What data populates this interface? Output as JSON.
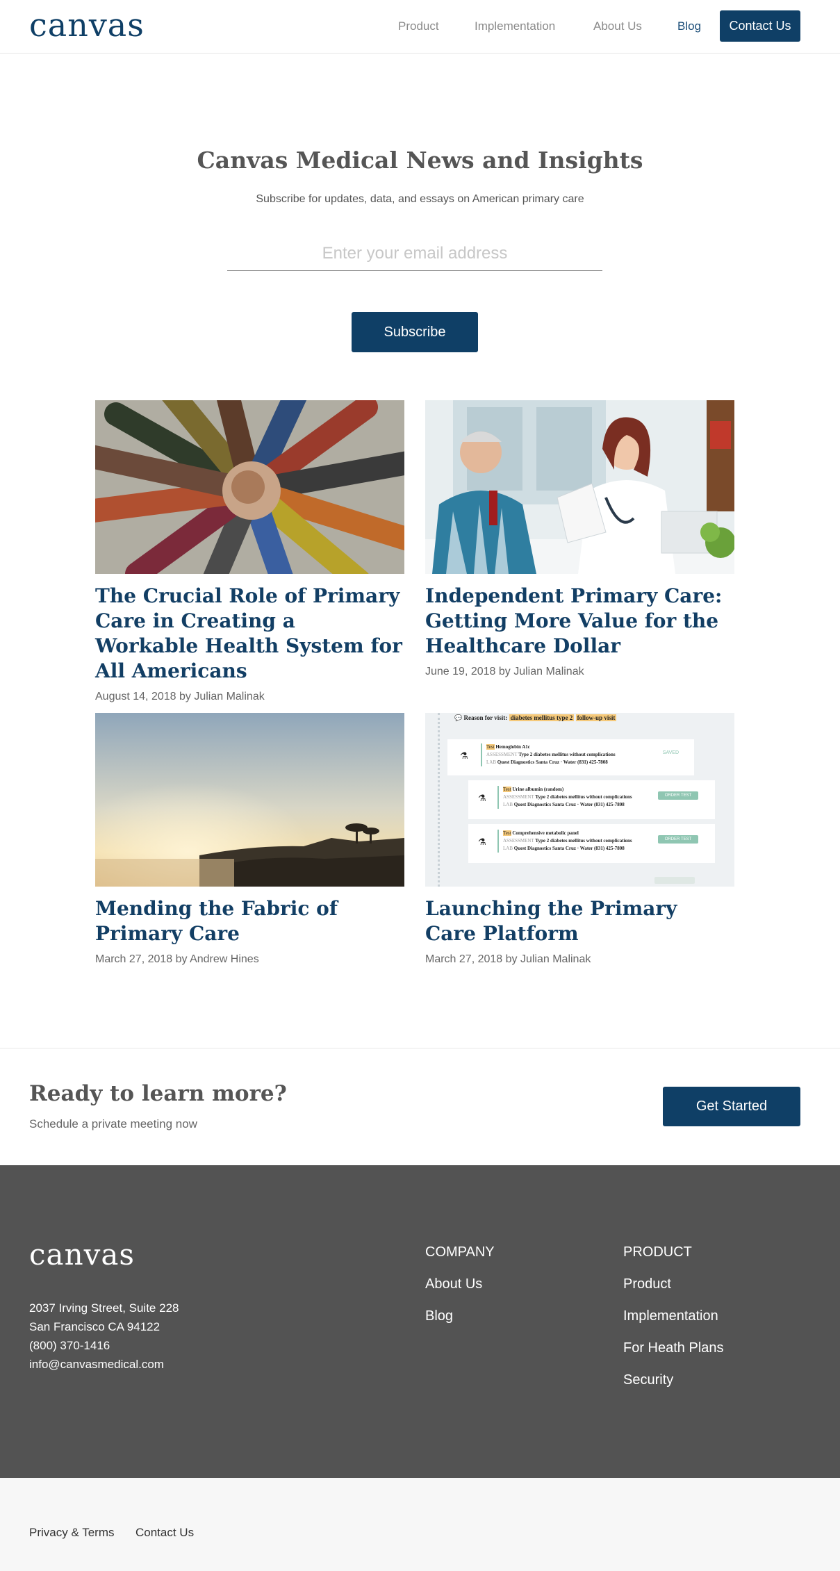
{
  "header": {
    "logo": "canvas",
    "nav": [
      "Product",
      "Implementation",
      "About Us",
      "Blog"
    ],
    "contact_label": "Contact Us"
  },
  "hero": {
    "title": "Canvas Medical News and Insights",
    "subtitle": "Subscribe for updates, data, and essays on American primary care",
    "email_placeholder": "Enter your email address",
    "subscribe_label": "Subscribe"
  },
  "posts": [
    {
      "title": "The Crucial Role of Primary Care in Creating a Workable Health System for All Americans",
      "meta": "August 14, 2018 by Julian Malinak"
    },
    {
      "title": "Independent Primary Care: Getting More Value for the Healthcare Dollar",
      "meta": "June 19, 2018 by Julian Malinak"
    },
    {
      "title": "Mending the Fabric of Primary Care",
      "meta": "March 27, 2018 by Andrew Hines"
    },
    {
      "title": "Launching the Primary Care Platform",
      "meta": "March 27, 2018 by Julian Malinak"
    }
  ],
  "screenshot_card": {
    "reason_label": "Reason for visit:",
    "reason_tag1": "diabetes mellitus type 2",
    "reason_tag2": "follow-up visit",
    "saved": "SAVED",
    "test_tag": "Test",
    "items": [
      {
        "name": "Hemoglobin A1c",
        "assessment": "Type 2 diabetes mellitus without complications",
        "lab": "Quest Diagnostics Santa Cruz · Water (831) 425-7808"
      },
      {
        "name": "Urine albumin (random)",
        "assessment": "Type 2 diabetes mellitus without complications",
        "lab": "Quest Diagnostics Santa Cruz · Water (831) 425-7808",
        "button": "ORDER TEST"
      },
      {
        "name": "Comprehensive metabolic panel",
        "assessment": "Type 2 diabetes mellitus without complications",
        "lab": "Quest Diagnostics Santa Cruz · Water (831) 425-7808",
        "button": "ORDER TEST"
      }
    ],
    "assessment_prefix": "ASSESSMENT",
    "lab_prefix": "LAB"
  },
  "cta": {
    "title": "Ready to learn more?",
    "subtitle": "Schedule a private meeting now",
    "button": "Get Started"
  },
  "footer": {
    "logo": "canvas",
    "address": [
      "2037 Irving Street, Suite 228",
      "San Francisco CA 94122",
      "(800) 370-1416",
      "info@canvasmedical.com"
    ],
    "company": {
      "title": "COMPANY",
      "links": [
        "About Us",
        "Blog"
      ]
    },
    "product": {
      "title": "PRODUCT",
      "links": [
        "Product",
        "Implementation",
        "For Heath Plans",
        "Security"
      ]
    }
  },
  "bottom": {
    "links": [
      "Privacy & Terms",
      "Contact Us"
    ]
  },
  "colors": {
    "brand": "#0f3f66",
    "footer_bg": "#535353",
    "link": "#123e64"
  }
}
